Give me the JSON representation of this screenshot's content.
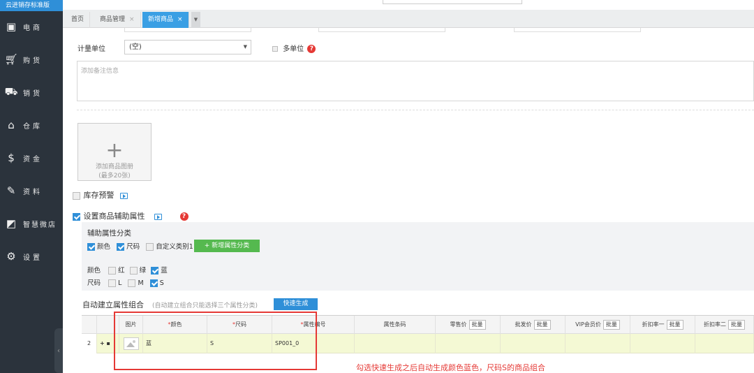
{
  "sidebar": {
    "brand": "云进销存标准版",
    "items": [
      {
        "label": "电商",
        "icon": "store-icon"
      },
      {
        "label": "购货",
        "icon": "cart-icon"
      },
      {
        "label": "销货",
        "icon": "sales-icon"
      },
      {
        "label": "仓库",
        "icon": "warehouse-icon"
      },
      {
        "label": "资金",
        "icon": "money-icon"
      },
      {
        "label": "资料",
        "icon": "pencil-icon"
      },
      {
        "label": "智慧微店",
        "icon": "shop-icon"
      },
      {
        "label": "设置",
        "icon": "gear-icon"
      }
    ]
  },
  "tabs": [
    {
      "label": "首页",
      "closable": false
    },
    {
      "label": "商品管理",
      "closable": true
    },
    {
      "label": "新增商品",
      "closable": true,
      "active": true
    }
  ],
  "form": {
    "unit_label": "计量单位",
    "unit_value": "(空)",
    "multi_unit_label": "多单位",
    "remark_placeholder": "添加备注信息",
    "upload_line1": "添加商品图册",
    "upload_line2": "(最多20张)",
    "stock_alert_label": "库存预警",
    "aux_attr_label": "设置商品辅助属性"
  },
  "aux": {
    "category_title": "辅助属性分类",
    "categories": [
      {
        "label": "颜色",
        "checked": true
      },
      {
        "label": "尺码",
        "checked": true
      },
      {
        "label": "自定义类别1",
        "checked": false
      }
    ],
    "add_button": "+ 新增属性分类",
    "color_label": "颜色",
    "colors": [
      {
        "label": "红",
        "checked": false
      },
      {
        "label": "绿",
        "checked": false
      },
      {
        "label": "蓝",
        "checked": true
      }
    ],
    "size_label": "尺码",
    "sizes": [
      {
        "label": "L",
        "checked": false
      },
      {
        "label": "M",
        "checked": false
      },
      {
        "label": "S",
        "checked": true
      }
    ]
  },
  "combo": {
    "title": "自动建立属性组合",
    "hint": "(自动建立组合只能选择三个属性分类)",
    "quick_button": "快速生成"
  },
  "table": {
    "headers": {
      "pic": "图片",
      "color": "颜色",
      "size": "尺码",
      "code": "属性编号",
      "barcode": "属性条码",
      "retail": "零售价",
      "wholesale": "批发价",
      "vip": "VIP会员价",
      "discount1": "折扣率一",
      "discount2": "折扣率二"
    },
    "batch_label": "批量",
    "row": {
      "index": "2",
      "color": "蓝",
      "size": "S",
      "code": "SP001_0"
    }
  },
  "annotation": "勾选快速生成之后自动生成颜色蓝色，尺码S的商品组合",
  "colors": {
    "accent": "#2f8fd8",
    "highlight_row": "#f4f9d4",
    "annotation": "#e53935",
    "sidebar": "#2b333c"
  }
}
